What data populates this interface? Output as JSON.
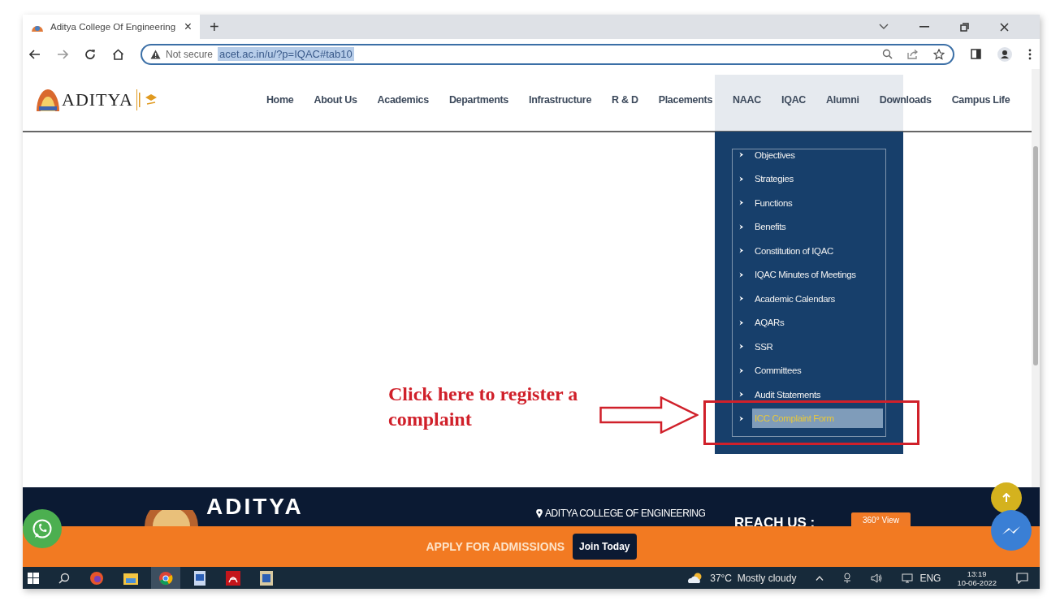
{
  "browser": {
    "tab": {
      "title": "Aditya College Of Engineering",
      "close": "×"
    },
    "new_tab": "+",
    "security": "Not secure",
    "url": "acet.ac.in/u/?p=IQAC#tab10"
  },
  "site": {
    "logo": "ADITYA",
    "nav": [
      "Home",
      "About Us",
      "Academics",
      "Departments",
      "Infrastructure",
      "R & D",
      "Placements",
      "NAAC",
      "IQAC",
      "Alumni",
      "Downloads",
      "Campus Life"
    ],
    "dropdown": [
      {
        "label": "Objectives",
        "selected": false
      },
      {
        "label": "Strategies",
        "selected": false
      },
      {
        "label": "Functions",
        "selected": false
      },
      {
        "label": "Benefits",
        "selected": false
      },
      {
        "label": "Constitution of IQAC",
        "selected": false
      },
      {
        "label": "IQAC Minutes of Meetings",
        "selected": false
      },
      {
        "label": "Academic Calendars",
        "selected": false
      },
      {
        "label": "AQARs",
        "selected": false
      },
      {
        "label": "SSR",
        "selected": false
      },
      {
        "label": "Committees",
        "selected": false
      },
      {
        "label": "Audit Statements",
        "selected": false
      },
      {
        "label": "ICC Complaint Form",
        "selected": true
      }
    ]
  },
  "annotation": {
    "text": "Click here to register a complaint"
  },
  "footer": {
    "brand": "ADITYA",
    "address": "ADITYA COLLEGE OF ENGINEERING",
    "reach": "REACH US :",
    "view_button": "360° View"
  },
  "admissions_bar": {
    "text": "APPLY FOR ADMISSIONS",
    "button": "Join Today"
  },
  "taskbar": {
    "weather": "37°C  Mostly cloudy",
    "language": "ENG",
    "time": "13:19",
    "date": "10-06-2022"
  }
}
